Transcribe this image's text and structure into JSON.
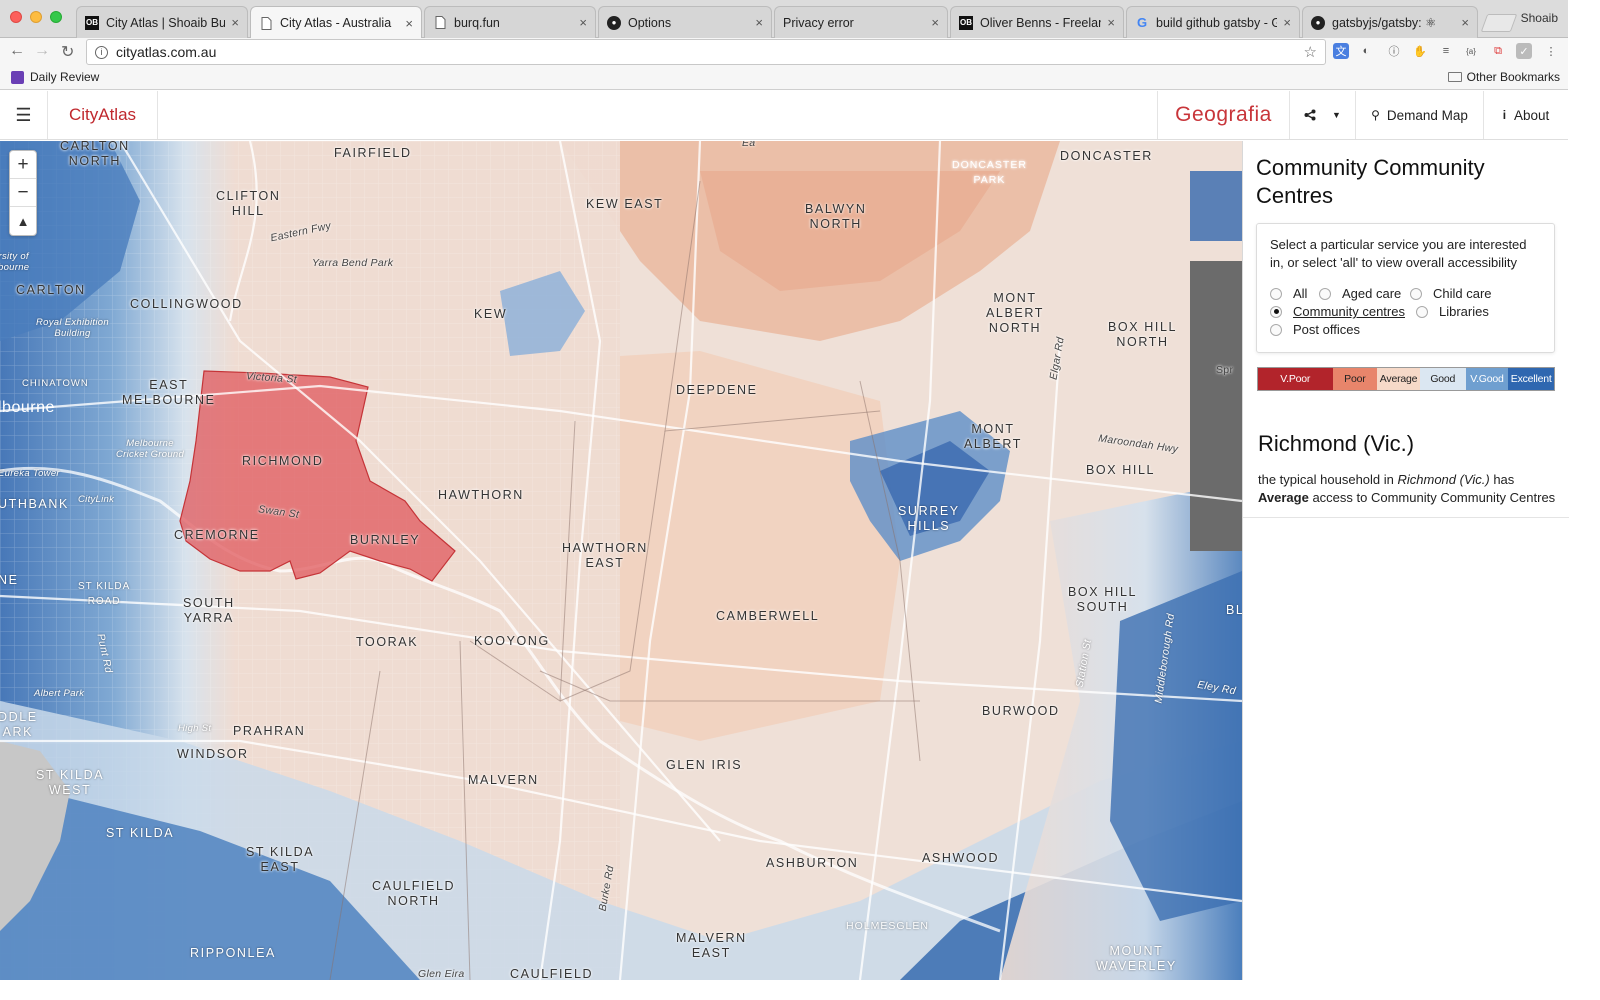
{
  "browser": {
    "tabs": [
      {
        "title": "City Atlas | Shoaib Burq",
        "active": false,
        "icon": "ob-icon"
      },
      {
        "title": "City Atlas - Australia",
        "active": true,
        "icon": "page-icon"
      },
      {
        "title": "burq.fun",
        "active": false,
        "icon": "page-icon"
      },
      {
        "title": "Options",
        "active": false,
        "icon": "github-icon"
      },
      {
        "title": "Privacy error",
        "active": false,
        "icon": "none"
      },
      {
        "title": "Oliver Benns - Freelance",
        "active": false,
        "icon": "ob-icon"
      },
      {
        "title": "build github gatsby - Go",
        "active": false,
        "icon": "google-icon"
      },
      {
        "title": "gatsbyjs/gatsby: ⚛",
        "active": false,
        "icon": "github-icon"
      }
    ],
    "profile_name": "Shoaib",
    "url": "cityatlas.com.au",
    "bookmarks": [
      {
        "label": "Daily Review",
        "icon": "sheet-icon"
      }
    ],
    "other_bookmarks_label": "Other Bookmarks",
    "close_glyph": "×"
  },
  "app": {
    "brand": "CityAtlas",
    "partner": "Geografia",
    "nav": {
      "demand_map_label": "Demand Map",
      "about_label": "About"
    }
  },
  "map": {
    "zoom_in_label": "+",
    "zoom_out_label": "−",
    "compass_label": "▲",
    "highlighted_suburb": "Richmond",
    "colors": {
      "v_poor": "#b2242b",
      "poor": "#e8856b",
      "average": "#f3d9c9",
      "good": "#d6e3ef",
      "v_good": "#6f9fd0",
      "excellent": "#2f67b0"
    },
    "labels": [
      {
        "text": "CARLTON\nNORTH"
      },
      {
        "text": "FAIRFIELD"
      },
      {
        "text": "DONCASTER"
      },
      {
        "text": "DONCASTER\nPARK"
      },
      {
        "text": "CLIFTON\nHILL"
      },
      {
        "text": "KEW EAST"
      },
      {
        "text": "BALWYN\nNORTH"
      },
      {
        "text": "Eastern Fwy"
      },
      {
        "text": "Yarra Bend Park"
      },
      {
        "text": "CARLTON"
      },
      {
        "text": "COLLINGWOOD"
      },
      {
        "text": "KEW"
      },
      {
        "text": "MONT\nALBERT\nNORTH"
      },
      {
        "text": "BOX HILL\nNORTH"
      },
      {
        "text": "Royal Exhibition\nBuilding"
      },
      {
        "text": "CHINATOWN"
      },
      {
        "text": "EAST\nMELBOURNE"
      },
      {
        "text": "Victoria St"
      },
      {
        "text": "lbourne"
      },
      {
        "text": "DEEPDENE"
      },
      {
        "text": "MONT\nALBERT"
      },
      {
        "text": "Maroondah Hwy"
      },
      {
        "text": "BOX HILL"
      },
      {
        "text": "Melbourne\nCricket Ground"
      },
      {
        "text": "RICHMOND"
      },
      {
        "text": "HAWTHORN"
      },
      {
        "text": "Eureka Tower"
      },
      {
        "text": "CityLink"
      },
      {
        "text": "UTHBANK"
      },
      {
        "text": "Swan St"
      },
      {
        "text": "SURREY\nHILLS"
      },
      {
        "text": "CREMORNE"
      },
      {
        "text": "BURNLEY"
      },
      {
        "text": "HAWTHORN\nEAST"
      },
      {
        "text": "ST KILDA\nROAD"
      },
      {
        "text": "SOUTH\nYARRA"
      },
      {
        "text": "BOX HILL\nSOUTH"
      },
      {
        "text": "CAMBERWELL"
      },
      {
        "text": "TOORAK"
      },
      {
        "text": "KOOYONG"
      },
      {
        "text": "Albert Park"
      },
      {
        "text": "BURWOOD"
      },
      {
        "text": "PRAHRAN"
      },
      {
        "text": "High St"
      },
      {
        "text": "DDLE\nARK"
      },
      {
        "text": "WINDSOR"
      },
      {
        "text": "GLEN IRIS"
      },
      {
        "text": "ST KILDA\nWEST"
      },
      {
        "text": "MALVERN"
      },
      {
        "text": "ST KILDA"
      },
      {
        "text": "ASHBURTON"
      },
      {
        "text": "ASHWOOD"
      },
      {
        "text": "ST KILDA\nEAST"
      },
      {
        "text": "CAULFIELD\nNORTH"
      },
      {
        "text": "MALVERN\nEAST"
      },
      {
        "text": "HOLMESGLEN"
      },
      {
        "text": "MOUNT\nWAVERLEY"
      },
      {
        "text": "RIPPONLEA"
      },
      {
        "text": "CAULFIELD"
      },
      {
        "text": "Glen Eira"
      },
      {
        "text": "Burke Rd"
      },
      {
        "text": "Elgar Rd"
      },
      {
        "text": "Station St"
      },
      {
        "text": "Middleborough Rd"
      },
      {
        "text": "Eley Rd"
      },
      {
        "text": "NE"
      },
      {
        "text": "Ea"
      },
      {
        "text": "Spr"
      },
      {
        "text": "Punt Rd"
      },
      {
        "text": "rsity of\nbourne"
      },
      {
        "text": "BL"
      }
    ]
  },
  "panel": {
    "title": "Community Community Centres",
    "instruction": "Select a particular service you are interested in, or select 'all' to view overall accessibility",
    "services": [
      {
        "label": "All",
        "selected": false
      },
      {
        "label": "Aged care",
        "selected": false
      },
      {
        "label": "Child care",
        "selected": false
      },
      {
        "label": "Community centres",
        "selected": true
      },
      {
        "label": "Libraries",
        "selected": false
      },
      {
        "label": "Post offices",
        "selected": false
      }
    ],
    "legend": [
      {
        "label": "V.Poor",
        "color": "#b2242b",
        "text_color": "#fff"
      },
      {
        "label": "Poor",
        "color": "#e8856b",
        "text_color": "#222"
      },
      {
        "label": "Average",
        "color": "#f6d9c8",
        "text_color": "#222"
      },
      {
        "label": "Good",
        "color": "#dbe7f2",
        "text_color": "#222"
      },
      {
        "label": "V.Good",
        "color": "#6f9fd0",
        "text_color": "#fff"
      },
      {
        "label": "Excellent",
        "color": "#2f67b0",
        "text_color": "#fff"
      }
    ],
    "suburb": "Richmond (Vic.)",
    "summary": {
      "prefix": "the typical household in ",
      "suburb_italic": "Richmond (Vic.)",
      "middle": " has ",
      "rating": "Average",
      "suffix": " access to Community Community Centres"
    }
  }
}
